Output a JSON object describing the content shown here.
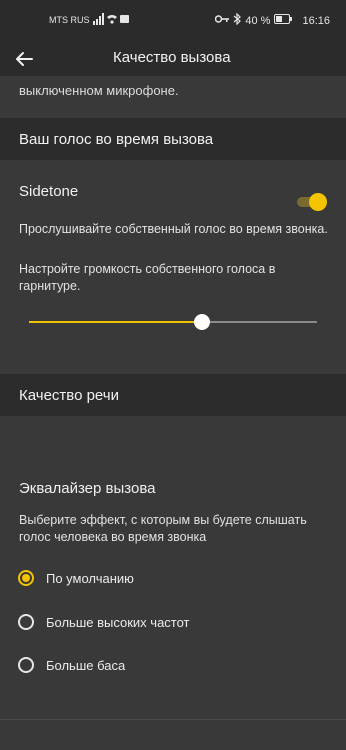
{
  "status_bar": {
    "carrier": "MTS RUS",
    "battery_percent": "40 %",
    "time": "16:16",
    "icons": [
      "signal-icon",
      "wifi-icon",
      "notification-icon",
      "key-icon",
      "bluetooth-icon",
      "battery-icon"
    ]
  },
  "app_bar": {
    "title": "Качество вызова",
    "back_icon": "back-arrow-icon"
  },
  "scrolled_text": "выключенном микрофоне.",
  "voice_section": {
    "header": "Ваш голос во время вызова",
    "sidetone_title": "Sidetone",
    "sidetone_desc_1": "Прослушивайте собственный голос во время звонка.",
    "sidetone_desc_2": "Настройте громкость собственного голоса в гарнитуре.",
    "toggle_on": true,
    "volume_fraction": 0.6
  },
  "speech_section": {
    "header": "Качество речи"
  },
  "equalizer": {
    "title": "Эквалайзер вызова",
    "description": "Выберите эффект, с которым вы будете слышать голос человека во время звонка",
    "options": [
      {
        "label": "По умолчанию",
        "selected": true
      },
      {
        "label": "Больше высоких частот",
        "selected": false
      },
      {
        "label": "Больше баса",
        "selected": false
      }
    ]
  },
  "colors": {
    "accent": "#f5c400",
    "background": "#393939",
    "header_bg": "#2c2c2c"
  }
}
